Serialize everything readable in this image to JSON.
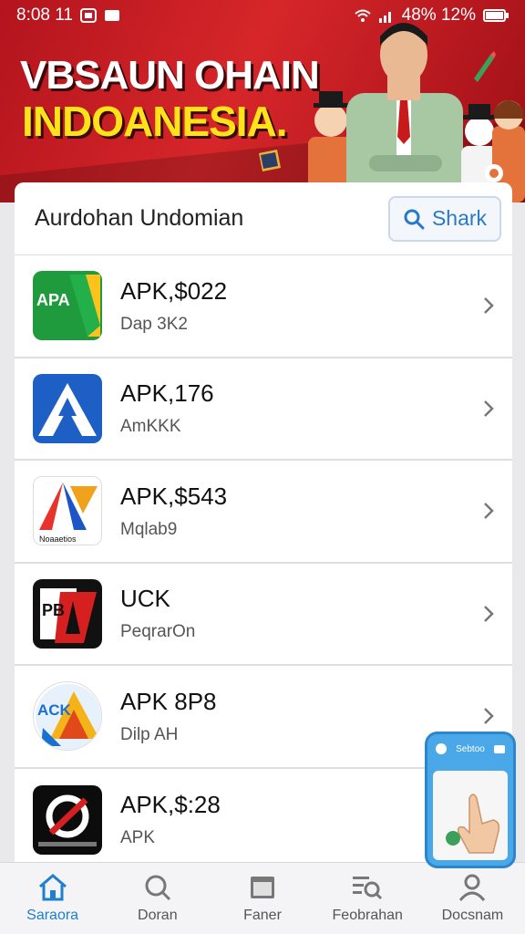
{
  "statusbar": {
    "left": "8:08 11",
    "right": "48% 12%"
  },
  "banner": {
    "title_line1": "VBSAUN OHAIN",
    "title_line2": "INDOANESIA."
  },
  "list": {
    "title": "Aurdohan Undomian",
    "search_label": "Shark",
    "items": [
      {
        "name": "APK,$022",
        "sub": "Dap 3K2",
        "icon": "green-apk-icon",
        "icon_text": "APA"
      },
      {
        "name": "APK,176",
        "sub": "AmKKK",
        "icon": "blue-a-icon",
        "icon_text": ""
      },
      {
        "name": "APK,$543",
        "sub": "Mqlab9",
        "icon": "colorful-a-icon",
        "icon_text": "Noaaetios"
      },
      {
        "name": "UCK",
        "sub": "PeqrarOn",
        "icon": "pdf-a-icon",
        "icon_text": "PB"
      },
      {
        "name": "APK 8P8",
        "sub": "Dilp AH",
        "icon": "ack-triangle-icon",
        "icon_text": "ACK"
      },
      {
        "name": "APK,$:28",
        "sub": "APK",
        "icon": "black-swirl-icon",
        "icon_text": ""
      }
    ]
  },
  "phone": {
    "label": "Sebtoo"
  },
  "nav": [
    {
      "label": "Saraora",
      "icon": "home-icon"
    },
    {
      "label": "Doran",
      "icon": "search-icon"
    },
    {
      "label": "Faner",
      "icon": "folder-icon"
    },
    {
      "label": "Feobrahan",
      "icon": "search-list-icon"
    },
    {
      "label": "Docsnam",
      "icon": "person-icon"
    }
  ],
  "colors": {
    "accent": "#1e7fd0",
    "banner_red": "#c9181f",
    "title_yellow": "#ffe21a"
  }
}
